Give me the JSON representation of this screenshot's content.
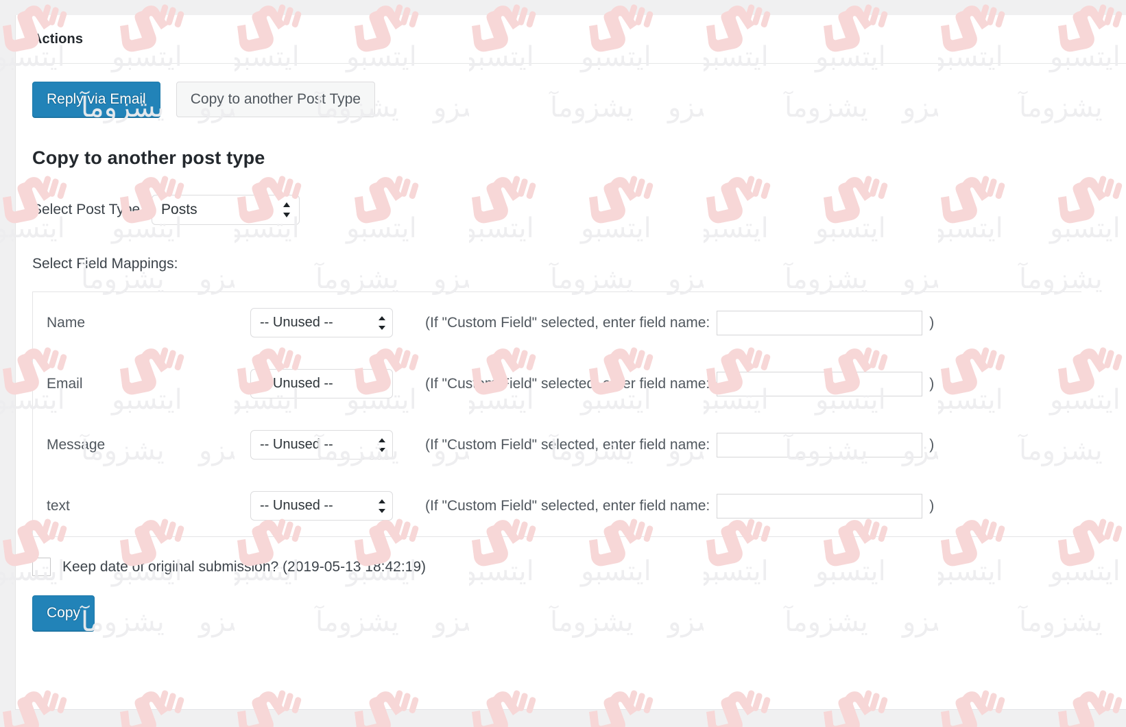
{
  "panel": {
    "header_title": "Actions"
  },
  "toolbar": {
    "reply_label": "Reply via Email",
    "copy_post_type_label": "Copy to another Post Type"
  },
  "section": {
    "title": "Copy to another post type",
    "post_type_label": "Select Post Type:",
    "post_type_value": "Posts",
    "post_type_options": [
      "Posts"
    ],
    "mappings_label": "Select Field Mappings:"
  },
  "mappings": {
    "custom_field_hint": "(If \"Custom Field\" selected, enter field name:",
    "closing_paren": ")",
    "unused_option": "-- Unused --",
    "rows": [
      {
        "name": "Name",
        "mapping": "-- Unused --",
        "custom_field_value": ""
      },
      {
        "name": "Email",
        "mapping": "-- Unused --",
        "custom_field_value": ""
      },
      {
        "name": "Message",
        "mapping": "-- Unused --",
        "custom_field_value": ""
      },
      {
        "name": "text",
        "mapping": "-- Unused --",
        "custom_field_value": ""
      }
    ]
  },
  "footer": {
    "keep_date_label": "Keep date of original submission? (2019-05-13 18:42:19)",
    "keep_date_checked": false,
    "copy_button_label": "Copy"
  },
  "colors": {
    "primary_button": "#2283b8",
    "page_background": "#f0f0f1",
    "panel_background": "#ffffff",
    "text": "#3c434a",
    "watermark_logo": "#f7d7d7",
    "watermark_text": "#ededef"
  },
  "watermark": {
    "logo_text": "SI",
    "script_text": "وبسایت آموزشی"
  }
}
